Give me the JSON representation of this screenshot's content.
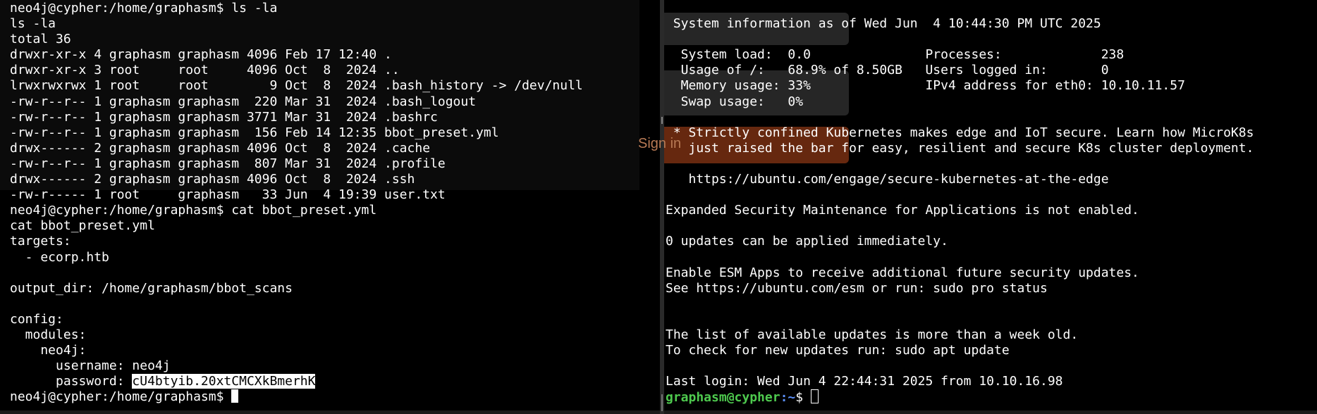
{
  "left_terminal": {
    "lines": [
      "neo4j@cypher:/home/graphasm$ ls -la",
      "ls -la",
      "total 36",
      "drwxr-xr-x 4 graphasm graphasm 4096 Feb 17 12:40 .",
      "drwxr-xr-x 3 root     root     4096 Oct  8  2024 ..",
      "lrwxrwxrwx 1 root     root        9 Oct  8  2024 .bash_history -> /dev/null",
      "-rw-r--r-- 1 graphasm graphasm  220 Mar 31  2024 .bash_logout",
      "-rw-r--r-- 1 graphasm graphasm 3771 Mar 31  2024 .bashrc",
      "-rw-r--r-- 1 graphasm graphasm  156 Feb 14 12:35 bbot_preset.yml",
      "drwx------ 2 graphasm graphasm 4096 Oct  8  2024 .cache",
      "-rw-r--r-- 1 graphasm graphasm  807 Mar 31  2024 .profile",
      "drwx------ 2 graphasm graphasm 4096 Oct  8  2024 .ssh",
      "-rw-r----- 1 root     graphasm   33 Jun  4 19:39 user.txt",
      "neo4j@cypher:/home/graphasm$ cat bbot_preset.yml",
      "cat bbot_preset.yml",
      "targets:",
      "  - ecorp.htb",
      "",
      "output_dir: /home/graphasm/bbot_scans",
      "",
      "config:",
      "  modules:",
      "    neo4j:",
      "      username: neo4j"
    ],
    "password_label": "      password: ",
    "password_value": "cU4btyib.20xtCMCXkBmerhK",
    "final_prompt": "neo4j@cypher:/home/graphasm$ "
  },
  "right_terminal": {
    "lines": [
      "",
      " System information as of Wed Jun  4 10:44:30 PM UTC 2025",
      "",
      "  System load:  0.0               Processes:             238",
      "  Usage of /:   68.9% of 8.50GB   Users logged in:       0",
      "  Memory usage: 33%               IPv4 address for eth0: 10.10.11.57",
      "  Swap usage:   0%",
      "",
      " * Strictly confined Kubernetes makes edge and IoT secure. Learn how MicroK8s",
      "   just raised the bar for easy, resilient and secure K8s cluster deployment.",
      "",
      "   https://ubuntu.com/engage/secure-kubernetes-at-the-edge",
      "",
      "Expanded Security Maintenance for Applications is not enabled.",
      "",
      "0 updates can be applied immediately.",
      "",
      "Enable ESM Apps to receive additional future security updates.",
      "See https://ubuntu.com/esm or run: sudo pro status",
      "",
      "",
      "The list of available updates is more than a week old.",
      "To check for new updates run: sudo apt update",
      "",
      "Last login: Wed Jun 4 22:44:31 2025 from 10.10.16.98"
    ],
    "prompt_user": "graphasm@cypher",
    "prompt_path": ":~",
    "prompt_symbol": "$ "
  },
  "ghost_overlay_text": "Sign in",
  "colors": {
    "background": "#000000",
    "text": "#ffffff",
    "prompt_user": "#4ec94e",
    "prompt_path": "#5b8ff9",
    "selection_bg": "#ffffff"
  }
}
